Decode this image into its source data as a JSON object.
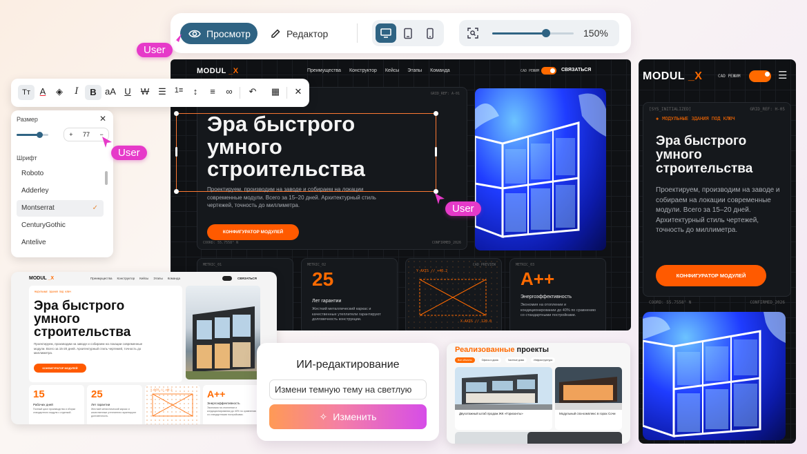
{
  "toolbar": {
    "view_label": "Просмотр",
    "edit_label": "Редактор",
    "zoom_value": "150%",
    "zoom_fraction": 0.66,
    "accent": "#2f6383"
  },
  "user_tags": {
    "label": "User"
  },
  "site": {
    "logo": "MODUL_X",
    "nav": [
      "Преимущества",
      "Конструктор",
      "Кейсы",
      "Этапы",
      "Команда"
    ],
    "cad_label": "CAD РЕЖИМ",
    "contact_button": "СВЯЗАТЬСЯ",
    "grid_ref": "GRID_REF: A-01",
    "hero_title_lines": [
      "Эра быстрого",
      "умного",
      "строительства"
    ],
    "hero_text": "Проектируем, производим на заводе и собираем на локации современные модули. Всего за 15–20 дней. Архитектурный стиль чертежей, точность до миллиметра.",
    "cta": "КОНФИГУРАТОР МОДУЛЕЙ",
    "coord": "COORD: 55.7558° N",
    "confirmed": "CONFIRMED_2026",
    "metric1_label": "METRIC_01",
    "metric2_label": "METRIC_02",
    "metric2_value": "25",
    "metric2_title": "Лет гарантии",
    "metric2_text": "Жесткий металлический каркас и качественные утеплители гарантируют долговечность конструкции.",
    "metric3_label": "CAD_PREVIEW",
    "metric3_y": "Y-AXIS // +40.2",
    "metric3_x": "X-AXIS // 120.0",
    "metric4_label": "METRIC_03",
    "metric4_value": "A++",
    "metric4_title": "Энергоэффективность",
    "metric4_text": "Экономия на отоплении и кондиционировании до 40% по сравнению со стандартными постройками.",
    "brand_orange": "#ff6a00"
  },
  "text_toolbar": {
    "items": [
      "text-size-icon",
      "text-color-icon",
      "highlight-icon",
      "italic-icon",
      "bold-icon",
      "font-case-icon",
      "underline-icon",
      "strikethrough-icon",
      "bullet-list-icon",
      "numbered-list-icon",
      "line-height-icon",
      "align-icon",
      "link-icon",
      "undo-link-icon",
      "checker-icon",
      "close-icon"
    ]
  },
  "font_panel": {
    "size_label": "Размер",
    "size_value": "77",
    "plus": "+",
    "minus": "−",
    "font_label": "Шрифт",
    "fonts": [
      "Roboto",
      "Adderley",
      "Montserrat",
      "CenturyGothic",
      "Antelive"
    ],
    "selected": "Montserrat"
  },
  "light_preview": {
    "logo": "MODUL_X",
    "nav": [
      "Преимущества",
      "Конструктор",
      "Кейсы",
      "Этапы",
      "Команда"
    ],
    "contact": "СВЯЗАТЬСЯ",
    "badge": "МОДУЛЬНЫЕ ЗДАНИЯ ПОД КЛЮЧ",
    "title_lines": [
      "Эра быстрого",
      "умного",
      "строительства"
    ],
    "text": "Проектируем, производим на заводе и собираем на локации современные модули. Всего за 15-20 дней. Архитектурный стиль чертежей, точность до миллиметра.",
    "cta": "КОНФИГУРАТОР МОДУЛЕЙ",
    "m1_value": "15",
    "m1_title": "Рабочих дней",
    "m1_text": "Полный цикл производства и сборки стандартного модуля с отделкой.",
    "m2_value": "25",
    "m2_title": "Лет гарантии",
    "m2_text": "Жесткий металлический каркас и качественные утеплители гарантируют долговечность.",
    "m3_y": "Y-AXIS // +40.2",
    "m4_value": "A++",
    "m4_title": "Энергоэффективность",
    "m4_text": "Экономия на отоплении и кондиционировании до 40% по сравнению со стандартными постройками."
  },
  "ai_panel": {
    "title": "ИИ-редактирование",
    "input_value": "Измени темную тему на светлую",
    "button": "Изменить"
  },
  "projects": {
    "title_a": "Реализованные",
    "title_b": " проекты",
    "filters": [
      "Все объекты",
      "Офисы и дома",
      "Частные дома",
      "Инфраструктура"
    ],
    "card1_title": "Двухэтажный штаб продаж ЖК «Горизонты»",
    "card2_title": "Модульный спа-комплекс в горах Сочи"
  },
  "mobile": {
    "logo": "MODUL_X",
    "cad_label": "CAD РЕЖИМ",
    "sys": "[SYS_INITIALIZED]",
    "grid_ref": "GRID_REF: H-05",
    "badge": "МОДУЛЬНЫЕ ЗДАНИЯ ПОД КЛЮЧ",
    "title_lines": [
      "Эра быстрого",
      "умного",
      "строительства"
    ],
    "text": "Проектируем, производим на заводе и собираем на локации современные модули. Всего за 15–20 дней. Архитектурный стиль чертежей, точность до миллиметра.",
    "cta": "КОНФИГУРАТОР МОДУЛЕЙ",
    "coord": "COORD: 55.7558° N",
    "confirmed": "CONFIRMED_2026"
  }
}
